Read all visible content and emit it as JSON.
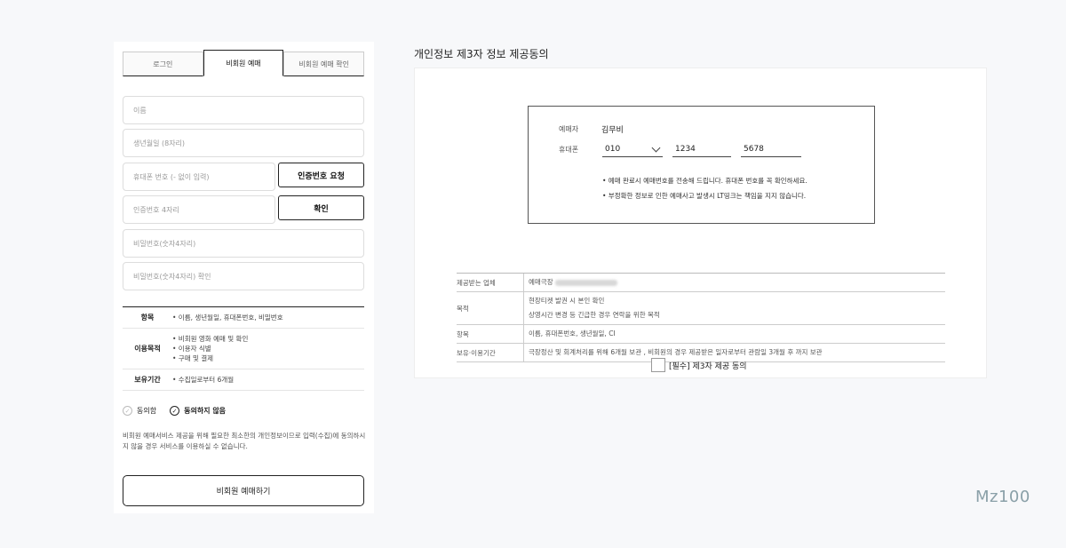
{
  "tabs": [
    "로그인",
    "비회원 예매",
    "비회원 예매 확인"
  ],
  "form": {
    "name_placeholder": "이름",
    "birth_placeholder": "생년월일 (8자리)",
    "phone_placeholder": "휴대폰 번호 (- 없이 입력)",
    "request_code_button": "인증번호 요청",
    "code_placeholder": "인증번호 4자리",
    "confirm_button": "확인",
    "password_placeholder": "비밀번호(숫자4자리)",
    "password_confirm_placeholder": "비밀번호(숫자4자리) 확인"
  },
  "terms": {
    "rows": [
      {
        "label": "항목",
        "items": [
          "• 이름, 생년월일, 휴대폰번호, 비밀번호"
        ]
      },
      {
        "label": "이용목적",
        "items": [
          "• 비회원 영화 예매 및 확인",
          "• 이용자 식별",
          "• 구매 및 결제"
        ]
      },
      {
        "label": "보유기간",
        "items": [
          "• 수집일로부터 6개월"
        ]
      }
    ],
    "agree": "동의함",
    "disagree": "동의하지 않음",
    "selected": "disagree",
    "notice": "비회원 예매서비스 제공을 위해 필요한 최소한의 개인정보이므로 입력(수집)에 동의하시지 않을 경우 서비스를 이용하실 수 없습니다."
  },
  "submit_button": "비회원 예매하기",
  "consent": {
    "title": "개인정보 제3자 정보 제공동의",
    "booker_label": "예매자",
    "booker_name": "김무비",
    "phone_label": "휴대폰",
    "phone_prefix": "010",
    "phone_mid": "1234",
    "phone_last": "5678",
    "bullets": [
      "• 예매 완료시 예매번호를 전송해 드립니다. 휴대폰 번호를 꼭 확인하세요.",
      "• 부정확한 정보로 인한 예매사고 발생시 LT띵크는 책임을 지지 않습니다."
    ],
    "table": [
      {
        "k": "제공받는 업체",
        "v": [
          "예매극장"
        ]
      },
      {
        "k": "목적",
        "v": [
          "현장티켓 발권 시 본인 확인",
          "상영시간 변경 등 긴급한 경우 연락을 위한 목적"
        ]
      },
      {
        "k": "항목",
        "v": [
          "이름, 휴대폰번호, 생년월일, CI"
        ]
      },
      {
        "k": "보유·이용기간",
        "v": [
          "극장정산 및 회계처리를 위해 6개월 보관 , 비회원의 경우 제공받은 일자로부터 관람일 3개월 후 까지 보관"
        ]
      }
    ],
    "checkbox_label": "[필수] 제3자 제공 동의"
  },
  "brand": "Mz100"
}
